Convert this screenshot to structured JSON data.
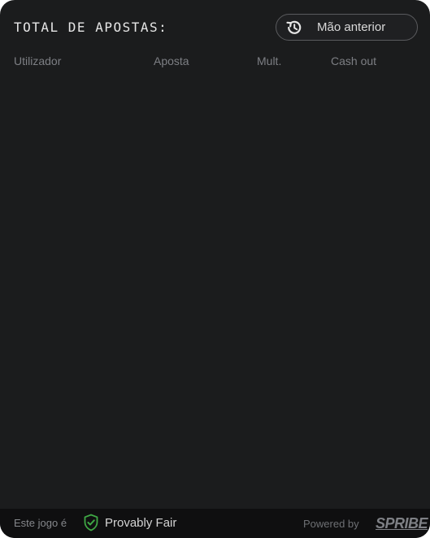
{
  "header": {
    "title": "TOTAL DE APOSTAS:",
    "previous_hand_button": {
      "label": "Mão anterior",
      "icon": "history-icon"
    }
  },
  "table": {
    "columns": [
      "Utilizador",
      "Aposta",
      "Mult.",
      "Cash out"
    ],
    "rows": []
  },
  "footer": {
    "fair_prefix": "Este jogo é",
    "fair_label": "Provably Fair",
    "fair_icon": "shield-check-icon",
    "fair_icon_color": "#3fa845",
    "powered_by": "Powered by",
    "brand": "SPRIBE"
  },
  "colors": {
    "panel_background": "#1b1c1d",
    "footer_background": "#0f0f10"
  }
}
